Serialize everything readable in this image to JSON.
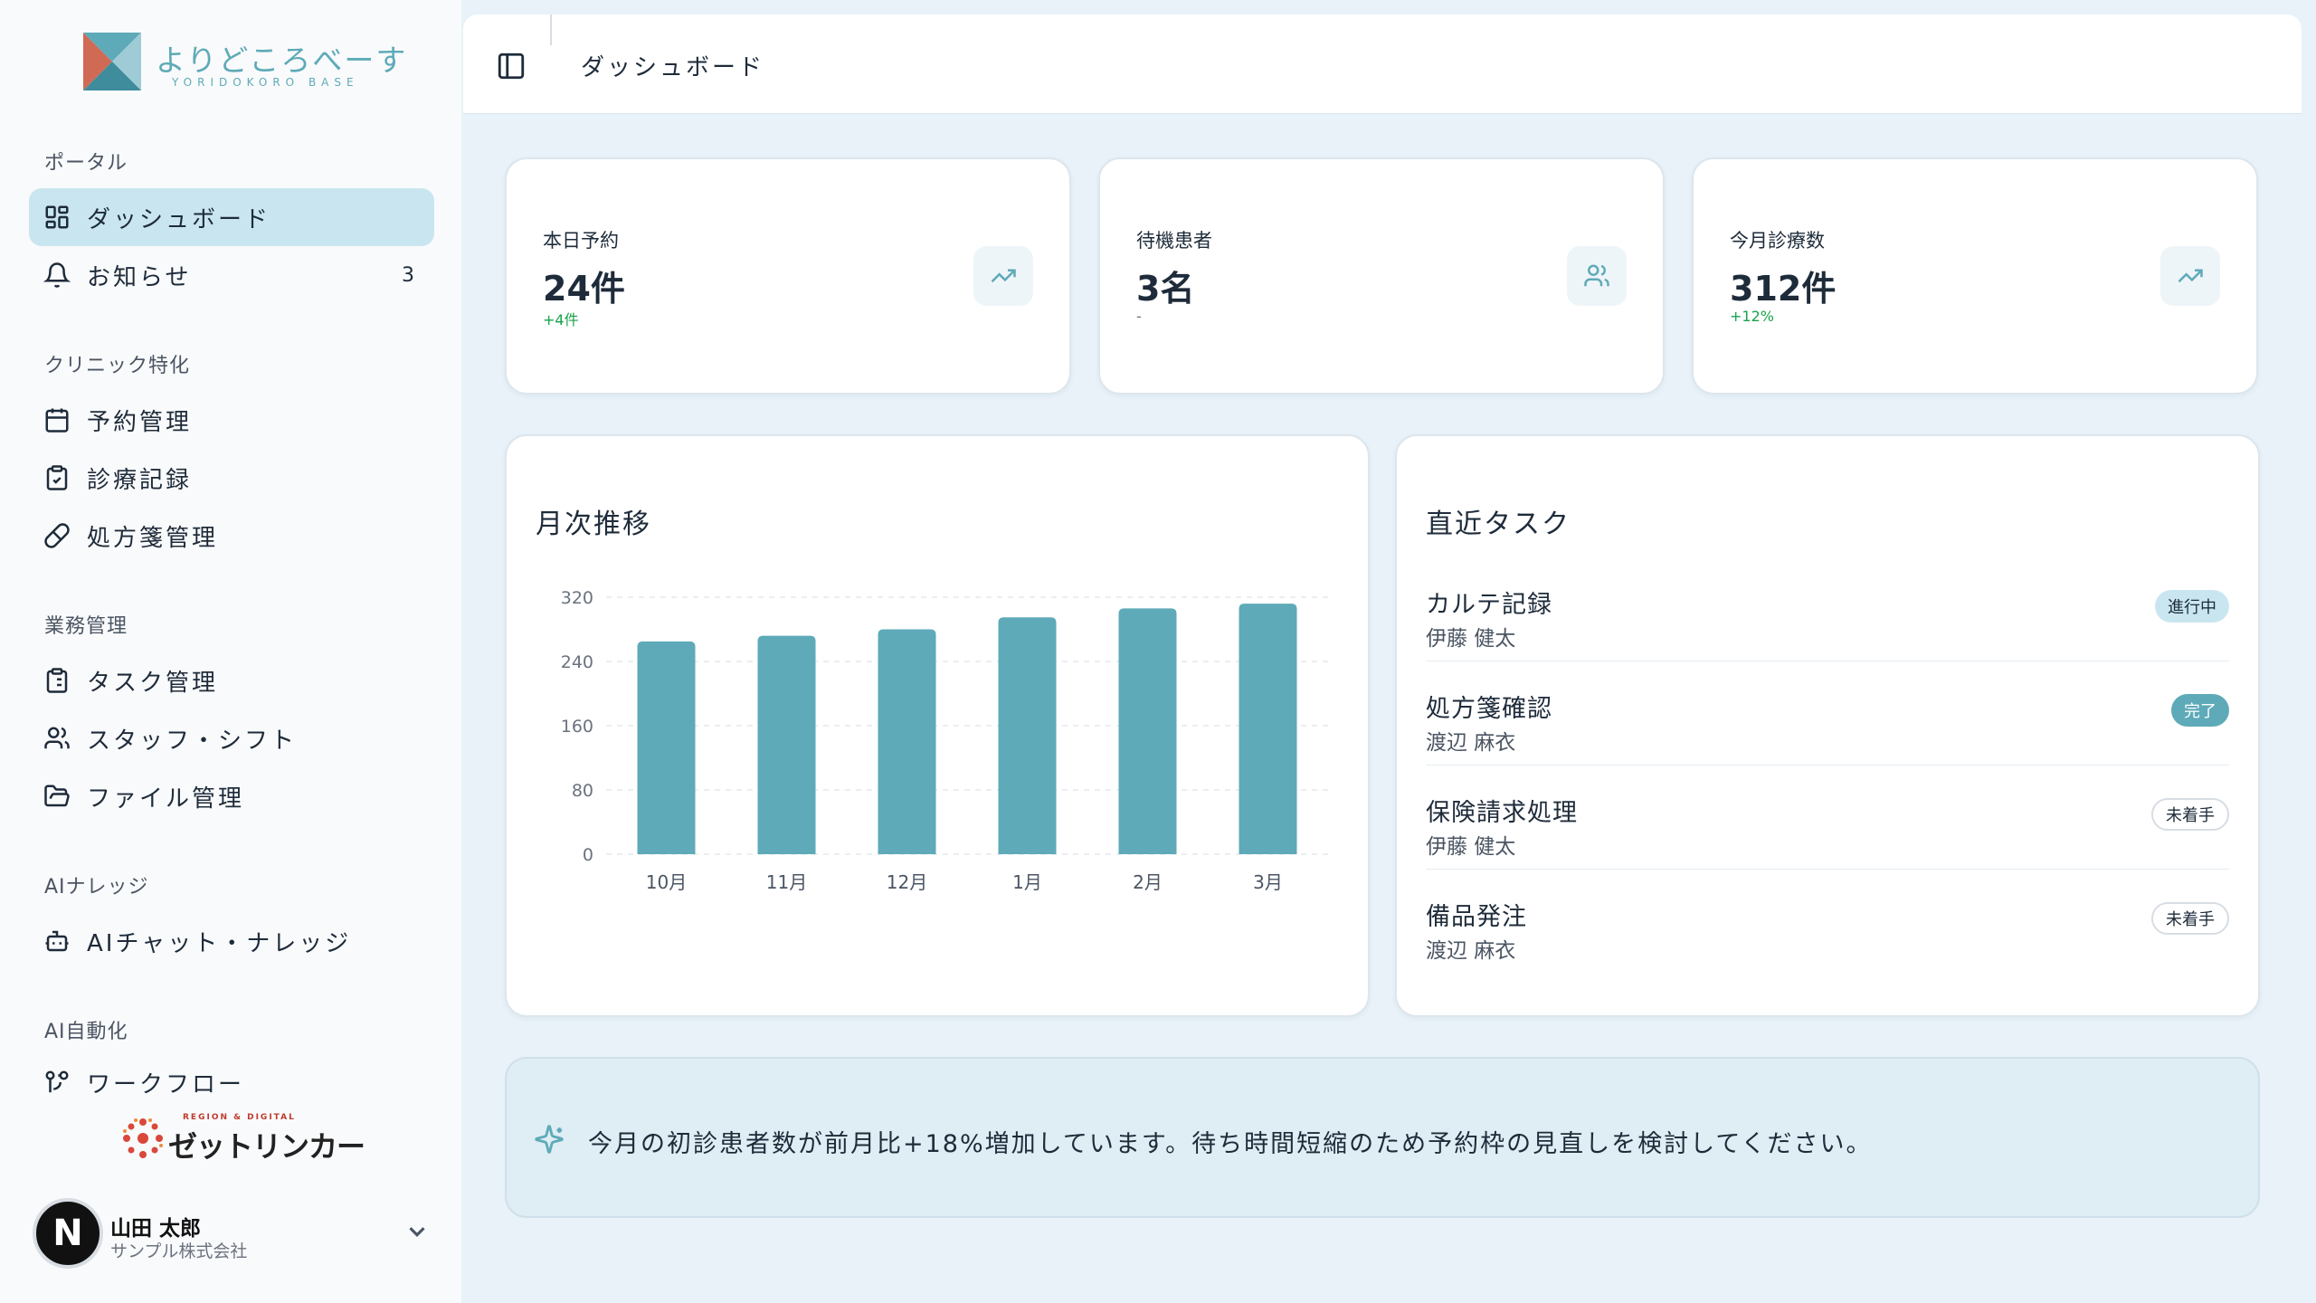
{
  "brand": {
    "name": "よりどころべーす",
    "sub": "YORIDOKORO BASE",
    "partner": "ゼットリンカー",
    "partner_tagline": "REGION & DIGITAL"
  },
  "sidebar": {
    "sections": [
      {
        "label": "ポータル"
      },
      {
        "label": "クリニック特化"
      },
      {
        "label": "業務管理"
      },
      {
        "label": "AIナレッジ"
      },
      {
        "label": "AI自動化"
      }
    ],
    "items": [
      {
        "label": "ダッシュボード",
        "icon": "dashboard-icon",
        "active": true
      },
      {
        "label": "お知らせ",
        "icon": "bell-icon",
        "badge": "3"
      },
      {
        "label": "予約管理",
        "icon": "calendar-icon"
      },
      {
        "label": "診療記録",
        "icon": "clipboard-check-icon"
      },
      {
        "label": "処方箋管理",
        "icon": "pill-icon"
      },
      {
        "label": "タスク管理",
        "icon": "clipboard-list-icon"
      },
      {
        "label": "スタッフ・シフト",
        "icon": "users-icon"
      },
      {
        "label": "ファイル管理",
        "icon": "folder-icon"
      },
      {
        "label": "AIチャット・ナレッジ",
        "icon": "bot-icon"
      },
      {
        "label": "ワークフロー",
        "icon": "workflow-icon"
      }
    ]
  },
  "user": {
    "initial": "N",
    "name": "山田 太郎",
    "org": "サンプル株式会社"
  },
  "header": {
    "title": "ダッシュボード"
  },
  "stats": [
    {
      "label": "本日予約",
      "value": "24件",
      "delta": "+4件",
      "icon": "trending-up-icon"
    },
    {
      "label": "待機患者",
      "value": "3名",
      "delta": "-",
      "icon": "users-icon"
    },
    {
      "label": "今月診療数",
      "value": "312件",
      "delta": "+12%",
      "icon": "trending-up-icon"
    }
  ],
  "monthly": {
    "title": "月次推移"
  },
  "chart_data": {
    "type": "bar",
    "categories": [
      "10月",
      "11月",
      "12月",
      "1月",
      "2月",
      "3月"
    ],
    "values": [
      265,
      272,
      280,
      295,
      306,
      312
    ],
    "yticks": [
      0,
      80,
      160,
      240,
      320
    ],
    "ylim": [
      0,
      320
    ],
    "grid": true,
    "color": "#5eaab8"
  },
  "tasks": {
    "title": "直近タスク",
    "items": [
      {
        "title": "カルテ記録",
        "assignee": "伊藤 健太",
        "status": "進行中",
        "kind": "progress"
      },
      {
        "title": "処方箋確認",
        "assignee": "渡辺 麻衣",
        "status": "完了",
        "kind": "done"
      },
      {
        "title": "保険請求処理",
        "assignee": "伊藤 健太",
        "status": "未着手",
        "kind": "todo"
      },
      {
        "title": "備品発注",
        "assignee": "渡辺 麻衣",
        "status": "未着手",
        "kind": "todo"
      }
    ]
  },
  "insight": {
    "text": "今月の初診患者数が前月比+18%増加しています。待ち時間短縮のため予約枠の見直しを検討してください。",
    "icon": "sparkles-icon"
  },
  "colors": {
    "accent": "#5eaab8",
    "active_bg": "#c9e6f0",
    "page_bg": "#e8f2f8",
    "positive": "#16a34a"
  }
}
